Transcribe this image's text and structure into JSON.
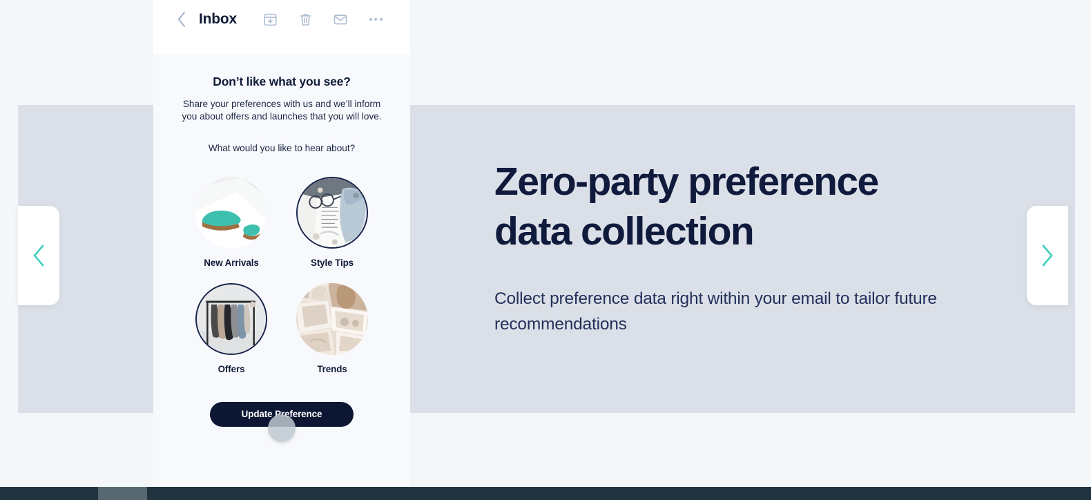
{
  "slide": {
    "hero_title_line1": "Zero-party preference",
    "hero_title_line2": "data collection",
    "hero_subtitle": "Collect preference data right within your email to tailor future recommendations",
    "prev_arrow_icon": "chevron-left-icon",
    "next_arrow_icon": "chevron-right-icon",
    "accent_color": "#3ecfc0",
    "panel_color": "#dbe0e8",
    "page_background": "#f4f7fa"
  },
  "email": {
    "header": {
      "back_icon": "chevron-left-icon",
      "mailbox": "Inbox",
      "tools": [
        {
          "name": "archive-icon",
          "label": "Archive"
        },
        {
          "name": "trash-icon",
          "label": "Delete"
        },
        {
          "name": "envelope-icon",
          "label": "Mark as unread"
        },
        {
          "name": "more-options-icon",
          "label": "More"
        }
      ],
      "icon_color": "#aebdd2",
      "title_color": "#101a36"
    },
    "body": {
      "title": "Don’t like what you see?",
      "subtitle": "Share your preferences with us and we’ll inform you about offers and launches that you will love.",
      "question": "What would you like to hear about?",
      "choices": [
        {
          "label": "New Arrivals",
          "image": "teal-shoes-photo",
          "selected": false
        },
        {
          "label": "Style Tips",
          "image": "glasses-and-handbag-photo",
          "selected": true
        },
        {
          "label": "Offers",
          "image": "clothing-rack-photo",
          "selected": true
        },
        {
          "label": "Trends",
          "image": "fashion-collage-photo",
          "selected": false
        }
      ],
      "cta_label": "Update Preference",
      "cta_background": "#0d1733",
      "selected_border_color": "#16224a"
    }
  },
  "bottom_bar": {
    "background": "#21333e",
    "thumb_color": "#56676f"
  }
}
